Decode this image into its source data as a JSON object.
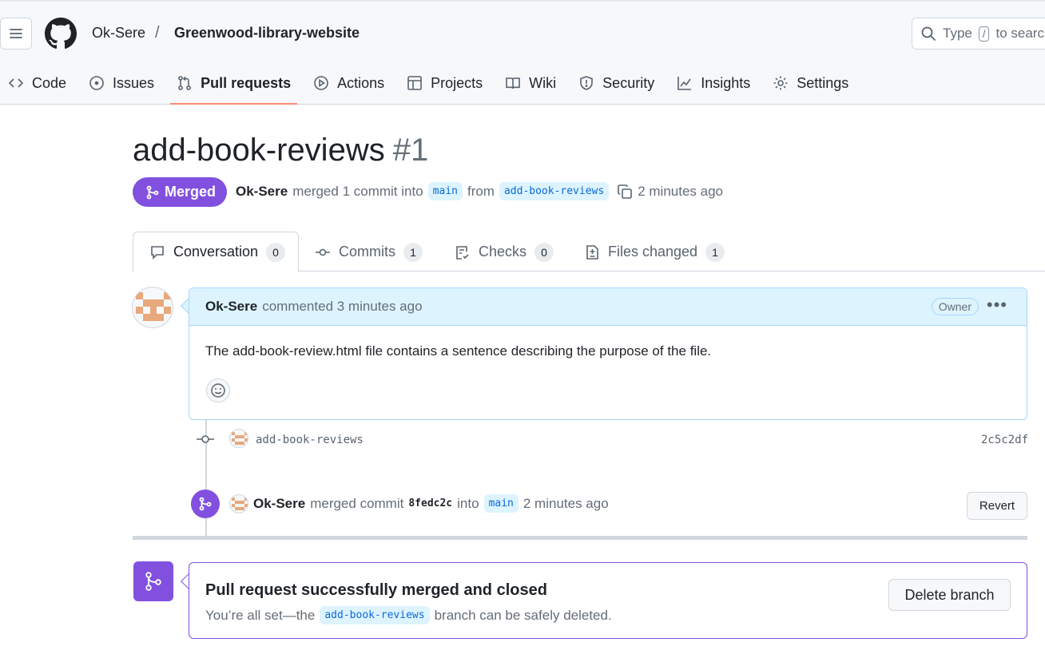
{
  "repo": {
    "owner": "Ok-Sere",
    "separator": "/",
    "name": "Greenwood-library-website"
  },
  "search": {
    "prefix": "Type",
    "key": "/",
    "suffix": "to search"
  },
  "nav": [
    {
      "label": "Code",
      "icon": "code-icon"
    },
    {
      "label": "Issues",
      "icon": "issue-icon"
    },
    {
      "label": "Pull requests",
      "icon": "pull-request-icon",
      "active": true
    },
    {
      "label": "Actions",
      "icon": "play-icon"
    },
    {
      "label": "Projects",
      "icon": "table-icon"
    },
    {
      "label": "Wiki",
      "icon": "book-icon"
    },
    {
      "label": "Security",
      "icon": "shield-icon"
    },
    {
      "label": "Insights",
      "icon": "graph-icon"
    },
    {
      "label": "Settings",
      "icon": "gear-icon"
    }
  ],
  "pr": {
    "title": "add-book-reviews",
    "number": "#1",
    "state": "Merged",
    "author": "Ok-Sere",
    "action_text": "merged 1 commit into",
    "base_branch": "main",
    "from_text": "from",
    "head_branch": "add-book-reviews",
    "time": "2 minutes ago"
  },
  "tabs": [
    {
      "label": "Conversation",
      "count": "0",
      "icon": "comment-icon"
    },
    {
      "label": "Commits",
      "count": "1",
      "icon": "commit-icon"
    },
    {
      "label": "Checks",
      "count": "0",
      "icon": "checklist-icon"
    },
    {
      "label": "Files changed",
      "count": "1",
      "icon": "file-diff-icon"
    }
  ],
  "comment": {
    "author": "Ok-Sere",
    "action": "commented 3 minutes ago",
    "role": "Owner",
    "menu": "•••",
    "body": "The add-book-review.html file contains a sentence describing the purpose of the file."
  },
  "commit": {
    "message": "add-book-reviews",
    "sha": "2c5c2df"
  },
  "merge_event": {
    "author": "Ok-Sere",
    "text": "merged commit",
    "sha": "8fedc2c",
    "into": "into",
    "branch": "main",
    "time": "2 minutes ago",
    "revert_label": "Revert"
  },
  "merge_box": {
    "title": "Pull request successfully merged and closed",
    "sub_prefix": "You’re all set—the",
    "branch": "add-book-reviews",
    "sub_suffix": "branch can be safely deleted.",
    "delete_label": "Delete branch"
  },
  "colors": {
    "merged": "#8250df",
    "tab_underline": "#fd8c73",
    "branch_bg": "#ddf4ff",
    "branch_fg": "#0969da"
  }
}
